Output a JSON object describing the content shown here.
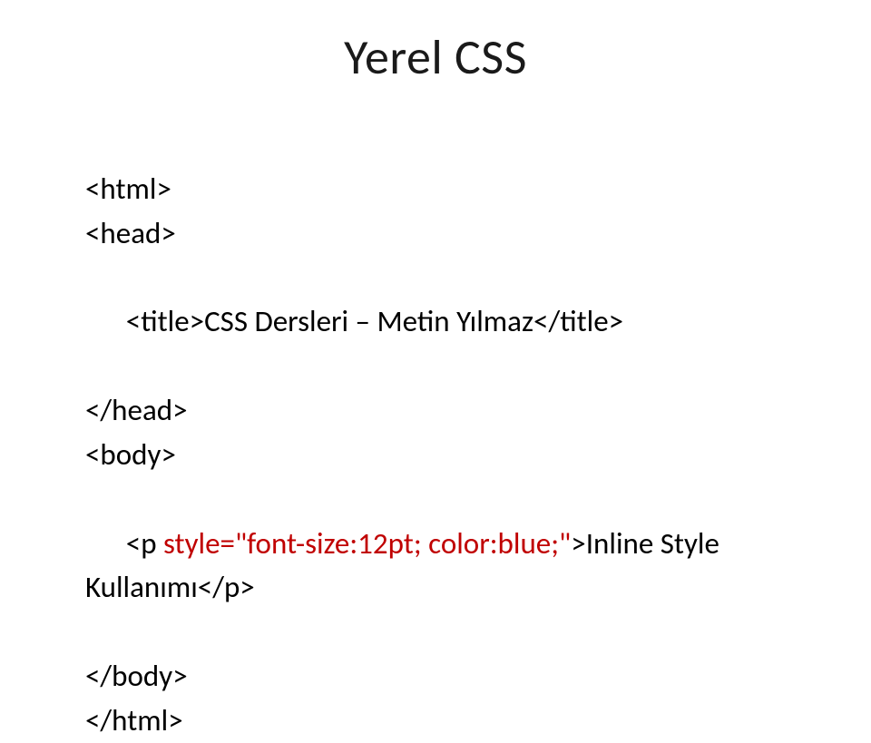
{
  "title": "Yerel CSS",
  "code": {
    "l1": "<html>",
    "l2": "<head>",
    "l3_a": "<title>",
    "l3_b": "CSS Dersleri – Metin Yılmaz",
    "l3_c": "</title>",
    "l4": "</head>",
    "l5": "<body>",
    "l6_a": "<p ",
    "l6_b": "style=\"font-size:12pt; color:blue;\"",
    "l6_c": ">",
    "l6_d": "Inline Style Kullanımı",
    "l6_e": "</p>",
    "l7": "</body>",
    "l8": "</html>"
  }
}
